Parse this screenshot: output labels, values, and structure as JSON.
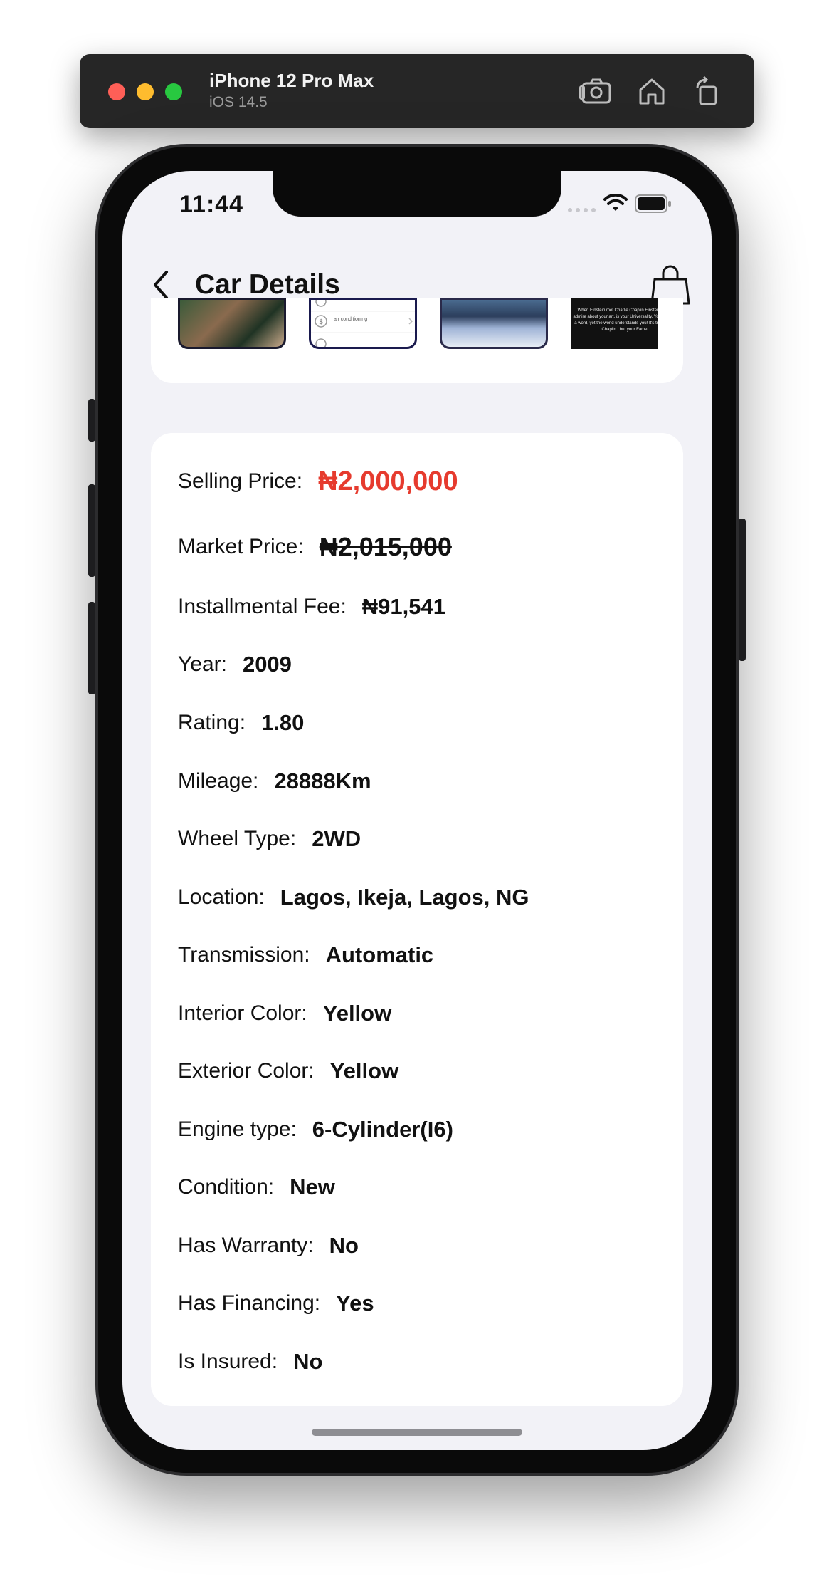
{
  "simulator": {
    "device_name": "iPhone 12 Pro Max",
    "os_version": "iOS 14.5",
    "icons": [
      "screenshot-icon",
      "home-icon",
      "rotate-icon"
    ]
  },
  "status_bar": {
    "time": "11:44"
  },
  "nav": {
    "title": "Car Details",
    "back_icon": "chevron-left-icon",
    "cart_icon": "shopping-bag-icon"
  },
  "gallery": {
    "thumbnails": [
      {
        "text": ""
      },
      {
        "text": "air conditioning"
      },
      {
        "text": ""
      },
      {
        "text": "When Einstein met Charlie Chaplin Einstein: What I admire about your art, is your Universality. You don't say a word, yet the world understands you! It's true, replied Chaplin...but your Fame..."
      }
    ]
  },
  "details": {
    "selling_price": {
      "label": "Selling Price:",
      "value": "₦2,000,000"
    },
    "market_price": {
      "label": "Market Price:",
      "value": "₦2,015,000"
    },
    "installmental_fee": {
      "label": "Installmental Fee:",
      "value": "₦91,541"
    },
    "year": {
      "label": "Year:",
      "value": "2009"
    },
    "rating": {
      "label": "Rating:",
      "value": "1.80"
    },
    "mileage": {
      "label": "Mileage:",
      "value": "28888Km"
    },
    "wheel_type": {
      "label": "Wheel Type:",
      "value": "2WD"
    },
    "location": {
      "label": "Location:",
      "value": "Lagos, Ikeja, Lagos, NG"
    },
    "transmission": {
      "label": "Transmission:",
      "value": "Automatic"
    },
    "interior_color": {
      "label": "Interior Color:",
      "value": "Yellow"
    },
    "exterior_color": {
      "label": "Exterior Color:",
      "value": "Yellow"
    },
    "engine_type": {
      "label": "Engine type:",
      "value": "6-Cylinder(I6)"
    },
    "condition": {
      "label": "Condition:",
      "value": "New"
    },
    "has_warranty": {
      "label": "Has Warranty:",
      "value": "No"
    },
    "has_financing": {
      "label": "Has Financing:",
      "value": "Yes"
    },
    "is_insured": {
      "label": "Is Insured:",
      "value": "No"
    }
  },
  "colors": {
    "selling_price": "#e63b2e",
    "background": "#f2f2f7",
    "card": "#ffffff"
  }
}
